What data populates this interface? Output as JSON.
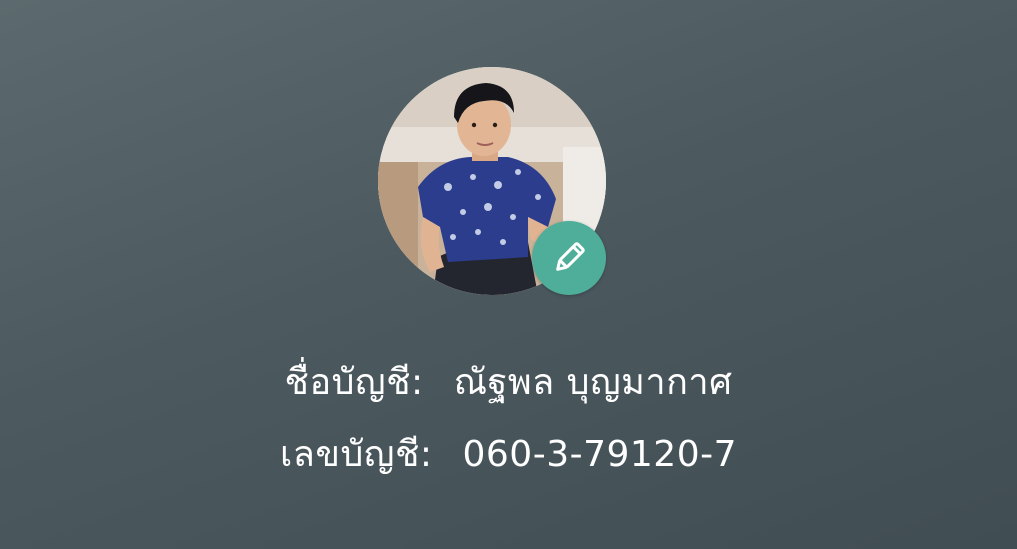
{
  "profile": {
    "avatar": {
      "icon": "person-photo",
      "edit_icon": "pencil-icon",
      "edit_color": "#4fae99"
    },
    "account_name": {
      "label": "ชื่อบัญชี:",
      "value": "ณัฐพล บุญมากาศ"
    },
    "account_number": {
      "label": "เลขบัญชี:",
      "value": "060-3-79120-7"
    }
  }
}
